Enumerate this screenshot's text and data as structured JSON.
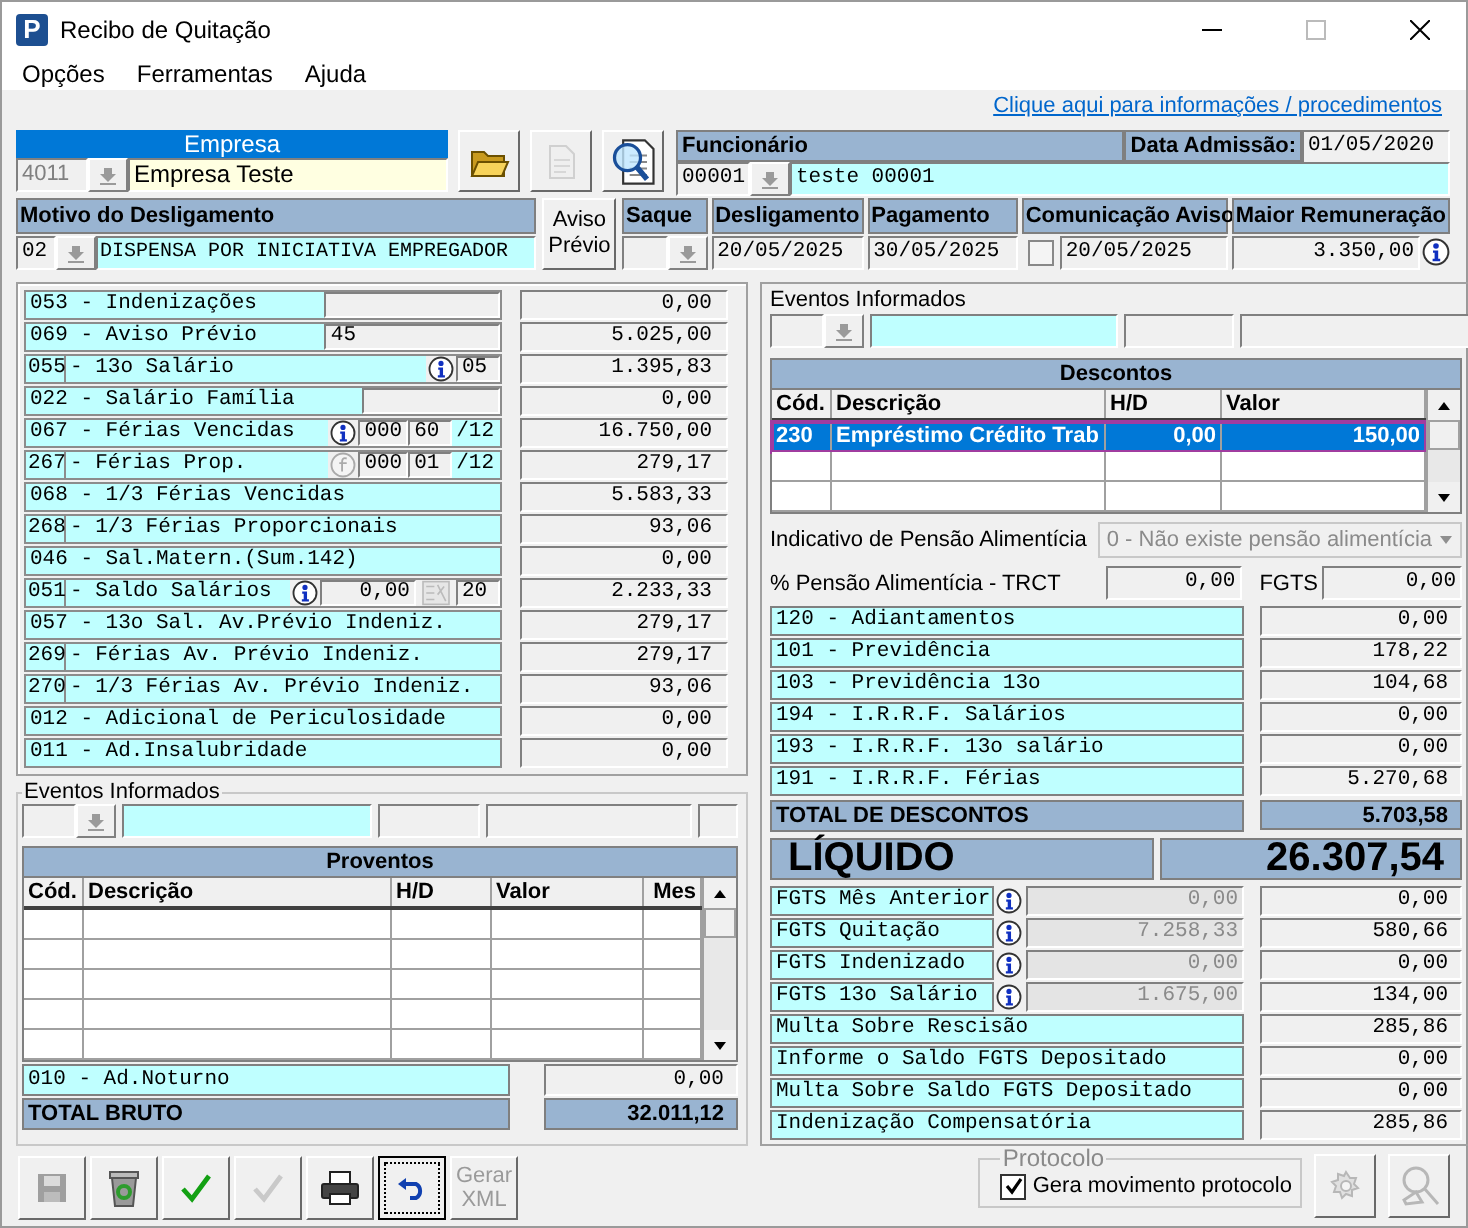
{
  "window": {
    "icon_letter": "P",
    "title": "Recibo de Quitação"
  },
  "menu": [
    {
      "label": "Opções"
    },
    {
      "label": "Ferramentas"
    },
    {
      "label": "Ajuda"
    }
  ],
  "help_link": "Clique aqui para informações / procedimentos",
  "empresa": {
    "label": "Empresa",
    "code": "4011",
    "name": "Empresa Teste"
  },
  "top_buttons": [
    {
      "kind": "folder",
      "disabled": false
    },
    {
      "kind": "document",
      "disabled": true
    },
    {
      "kind": "search",
      "disabled": false
    }
  ],
  "funcionario": {
    "label": "Funcionário",
    "code": "00001",
    "name": "teste 00001",
    "admission_label": "Data Admissão:",
    "admission": "01/05/2020"
  },
  "motivo": {
    "label": "Motivo do Desligamento",
    "code": "02",
    "text": "DISPENSA POR INICIATIVA EMPREGADOR"
  },
  "aviso_previo_button": "Aviso Prévio",
  "dates": [
    {
      "kind": "saque",
      "label": "Saque"
    },
    {
      "kind": "date",
      "label": "Desligamento",
      "value": "20/05/2025"
    },
    {
      "kind": "date",
      "label": "Pagamento",
      "value": "30/05/2025"
    },
    {
      "kind": "check",
      "label": "Comunicação Aviso",
      "checked": false,
      "value": "20/05/2025"
    },
    {
      "kind": "info",
      "label": "Maior Remuneração",
      "value": "3.350,00"
    }
  ],
  "earnings": [
    {
      "kind": "single",
      "label": "053 - Indenizações",
      "inputs": [
        {
          "kind": "field"
        }
      ],
      "value": "0,00"
    },
    {
      "kind": "single",
      "label": "069 - Aviso Prévio",
      "inputs": [
        {
          "kind": "field",
          "text": "45"
        }
      ],
      "value": "5.025,00"
    },
    {
      "kind": "split",
      "code": "055",
      "label": "- 13o Salário",
      "inputs": [
        {
          "kind": "info"
        },
        {
          "kind": "field",
          "text": "05"
        }
      ],
      "value": "1.395,83"
    },
    {
      "kind": "single",
      "label": "022 - Salário Família",
      "inputs": [
        {
          "kind": "field"
        }
      ],
      "value": "0,00"
    },
    {
      "kind": "single",
      "label": "067 - Férias Vencidas",
      "inputs": [
        {
          "kind": "info"
        },
        {
          "kind": "field",
          "text": "000"
        },
        {
          "kind": "field",
          "text": "60"
        },
        {
          "kind": "suffix",
          "text": "/12"
        }
      ],
      "value": "16.750,00"
    },
    {
      "kind": "split",
      "code": "267",
      "label": "- Férias Prop.",
      "inputs": [
        {
          "kind": "formula"
        },
        {
          "kind": "field",
          "text": "000"
        },
        {
          "kind": "field",
          "text": "01"
        },
        {
          "kind": "suffix",
          "text": "/12"
        }
      ],
      "value": "279,17"
    },
    {
      "kind": "single",
      "label": "068 - 1/3 Férias Vencidas",
      "value": "5.583,33"
    },
    {
      "kind": "split",
      "code": "268",
      "label": "- 1/3 Férias Proporcionais",
      "value": "93,06"
    },
    {
      "kind": "single",
      "label": "046 - Sal.Matern.(Sum.142)",
      "value": "0,00"
    },
    {
      "kind": "split",
      "code": "051",
      "label": "- Saldo Salários",
      "inputs": [
        {
          "kind": "info"
        },
        {
          "kind": "amount",
          "text": "0,00"
        },
        {
          "kind": "calc"
        },
        {
          "kind": "field",
          "text": "20"
        }
      ],
      "value": "2.233,33"
    },
    {
      "kind": "single",
      "label": "057 - 13o Sal. Av.Prévio Indeniz.",
      "value": "279,17"
    },
    {
      "kind": "split",
      "code": "269",
      "label": "- Férias  Av. Prévio Indeniz.",
      "value": "279,17"
    },
    {
      "kind": "split",
      "code": "270",
      "label": "- 1/3 Férias Av. Prévio Indeniz.",
      "value": "93,06"
    },
    {
      "kind": "single",
      "label": "012 - Adicional de Periculosidade",
      "value": "0,00"
    },
    {
      "kind": "single",
      "label": "011 - Ad.Insalubridade",
      "value": "0,00"
    }
  ],
  "left_events": {
    "label": "Eventos Informados"
  },
  "earnings_table": {
    "title": "Proventos",
    "columns": [
      "Cód.",
      "Descrição",
      "H/D",
      "Valor",
      "Mes"
    ]
  },
  "night_shift": {
    "label": "010 - Ad.Noturno",
    "value": "0,00"
  },
  "gross_total": {
    "label": "TOTAL BRUTO",
    "value": "32.011,12"
  },
  "bottom_buttons": [
    {
      "kind": "save",
      "disabled": true,
      "focused": false
    },
    {
      "kind": "trash",
      "disabled": false,
      "focused": false
    },
    {
      "kind": "confirm",
      "disabled": false,
      "focused": false
    },
    {
      "kind": "confirm",
      "disabled": true,
      "focused": false
    },
    {
      "kind": "print",
      "disabled": false,
      "focused": false
    },
    {
      "kind": "undo",
      "disabled": false,
      "focused": true
    },
    {
      "kind": "text",
      "label": "Gerar XML",
      "disabled": true,
      "focused": false
    }
  ],
  "right_events": {
    "label": "Eventos Informados"
  },
  "deductions_table": {
    "title": "Descontos",
    "columns": [
      "Cód.",
      "Descrição",
      "H/D",
      "Valor"
    ],
    "rows": [
      {
        "cells": [
          "230",
          "Empréstimo Crédito Trab",
          "0,00",
          "150,00"
        ],
        "selected": true
      }
    ]
  },
  "alimony": {
    "label": "Indicativo de Pensão Alimentícia",
    "value": "0 - Não existe pensão alimentícia",
    "disabled": true
  },
  "alimony_percent": {
    "label": "% Pensão Alimentícia - TRCT",
    "value": "0,00"
  },
  "fgts_field": {
    "label": "FGTS",
    "value": "0,00"
  },
  "deductions": [
    {
      "label": "120 - Adiantamentos",
      "value": "0,00"
    },
    {
      "label": "101 - Previdência",
      "value": "178,22"
    },
    {
      "label": "103 - Previdência 13o",
      "value": "104,68"
    },
    {
      "label": "194 - I.R.R.F. Salários",
      "value": "0,00"
    },
    {
      "label": "193 - I.R.R.F. 13o salário",
      "value": "0,00"
    },
    {
      "label": "191 - I.R.R.F. Férias",
      "value": "5.270,68"
    }
  ],
  "deductions_total": {
    "label": "TOTAL DE DESCONTOS",
    "value": "5.703,58"
  },
  "net": {
    "label": "LÍQUIDO",
    "value": "26.307,54"
  },
  "fgts": [
    {
      "kind": "info",
      "label": "FGTS Mês Anterior",
      "base": "0,00",
      "value": "0,00"
    },
    {
      "kind": "info",
      "label": "FGTS Quitação",
      "base": "7.258,33",
      "value": "580,66"
    },
    {
      "kind": "info",
      "label": "FGTS Indenizado",
      "base": "0,00",
      "value": "0,00"
    },
    {
      "kind": "info",
      "label": "FGTS 13o Salário",
      "base": "1.675,00",
      "value": "134,00"
    },
    {
      "kind": "plain",
      "label": "Multa Sobre Rescisão",
      "value": "285,86"
    },
    {
      "kind": "plain",
      "label": "Informe o Saldo FGTS Depositado",
      "value": "0,00"
    },
    {
      "kind": "plain",
      "label": "Multa Sobre Saldo FGTS Depositado",
      "value": "0,00"
    },
    {
      "kind": "plain",
      "label": "Indenização Compensatória",
      "value": "285,86"
    }
  ],
  "protocol": {
    "label": "Protocolo",
    "checkbox_label": "Gera movimento protocolo",
    "checked": true
  },
  "side_buttons": [
    {
      "kind": "gear",
      "disabled": true
    },
    {
      "kind": "tools",
      "disabled": true
    }
  ]
}
